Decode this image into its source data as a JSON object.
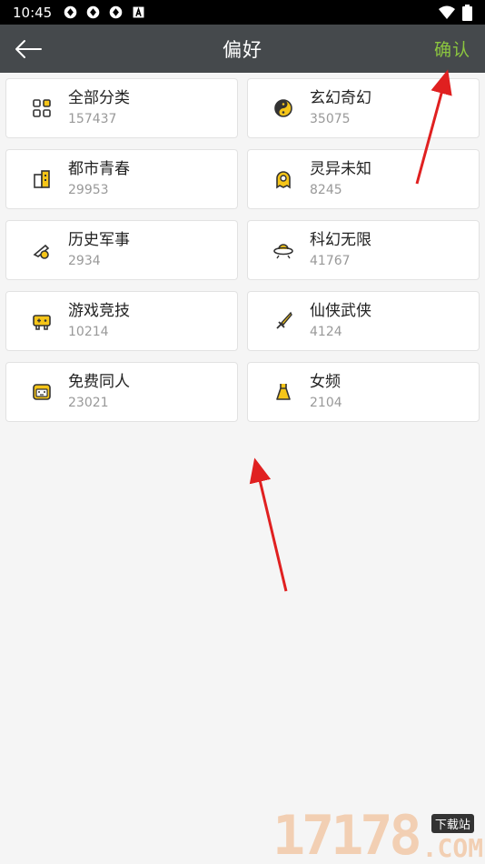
{
  "status_bar": {
    "time": "10:45",
    "notification_icons": [
      "sync-icon",
      "sync-icon",
      "sync-icon",
      "a-icon"
    ],
    "right_icons": [
      "wifi-icon",
      "battery-icon"
    ]
  },
  "app_bar": {
    "title": "偏好",
    "confirm_label": "确认",
    "back_icon": "arrow-left-icon",
    "confirm_color": "#8cc63f"
  },
  "categories": [
    {
      "name": "全部分类",
      "count": "157437",
      "icon": "grid-icon"
    },
    {
      "name": "玄幻奇幻",
      "count": "35075",
      "icon": "yin-yang-icon"
    },
    {
      "name": "都市青春",
      "count": "29953",
      "icon": "building-icon"
    },
    {
      "name": "灵异未知",
      "count": "8245",
      "icon": "ghost-icon"
    },
    {
      "name": "历史军事",
      "count": "2934",
      "icon": "cannon-icon"
    },
    {
      "name": "科幻无限",
      "count": "41767",
      "icon": "ufo-icon"
    },
    {
      "name": "游戏竞技",
      "count": "10214",
      "icon": "gamepad-icon"
    },
    {
      "name": "仙侠武侠",
      "count": "4124",
      "icon": "sword-icon"
    },
    {
      "name": "免费同人",
      "count": "23021",
      "icon": "face-icon"
    },
    {
      "name": "女频",
      "count": "2104",
      "icon": "dress-icon"
    }
  ],
  "watermark": {
    "number": "17178",
    "badge": "下载站",
    "suffix": ".COM"
  },
  "colors": {
    "app_bar_bg": "#45494c",
    "icon_yellow": "#f5c518",
    "annotation_arrow": "#e02020"
  }
}
